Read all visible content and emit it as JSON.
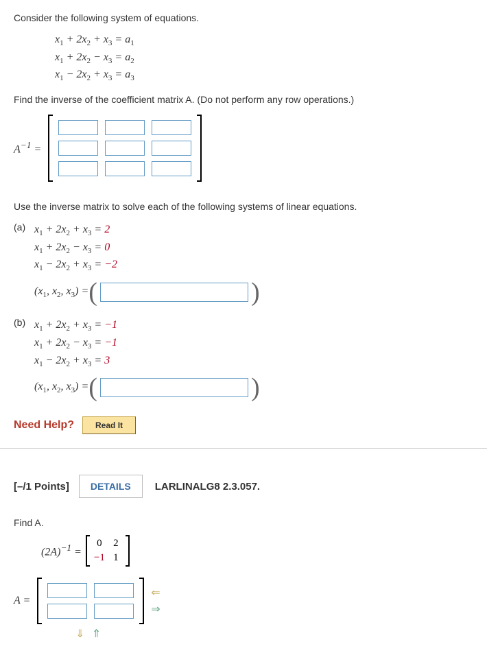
{
  "q1": {
    "intro": "Consider the following system of equations.",
    "sysA": {
      "l1": "x₁ + 2x₂ + x₃ = a₁",
      "l2": "x₁ + 2x₂ − x₃ = a₂",
      "l3": "x₁ − 2x₂ + x₃ = a₃"
    },
    "task1": "Find the inverse of the coefficient matrix A. (Do not perform any row operations.)",
    "invLabel": "A⁻¹ =",
    "task2": "Use the inverse matrix to solve each of the following systems of linear equations.",
    "partA_letter": "(a)",
    "partA": {
      "l1_lhs": "x₁ + 2x₂ + x₃ = ",
      "l1_rhs": "2",
      "l2_lhs": "x₁ + 2x₂ − x₃ = ",
      "l2_rhs": "0",
      "l3_lhs": "x₁ − 2x₂ + x₃ = ",
      "l3_rhs": "−2"
    },
    "partB_letter": "(b)",
    "partB": {
      "l1_lhs": "x₁ + 2x₂ + x₃ = ",
      "l1_rhs": "−1",
      "l2_lhs": "x₁ + 2x₂ − x₃ = ",
      "l2_rhs": "−1",
      "l3_lhs": "x₁ − 2x₂ + x₃ = ",
      "l3_rhs": "3"
    },
    "ansLabel": "(x₁, x₂, x₃) = ",
    "helpLabel": "Need Help?",
    "readIt": "Read It"
  },
  "q2": {
    "points": "[–/1 Points]",
    "details": "DETAILS",
    "ref": "LARLINALG8 2.3.057.",
    "findA": "Find A.",
    "twoAinv": "(2A)⁻¹ = ",
    "mat": {
      "r1c1": "0",
      "r1c2": "2",
      "r2c1": "−1",
      "r2c2": "1"
    },
    "Alabel": "A ="
  }
}
